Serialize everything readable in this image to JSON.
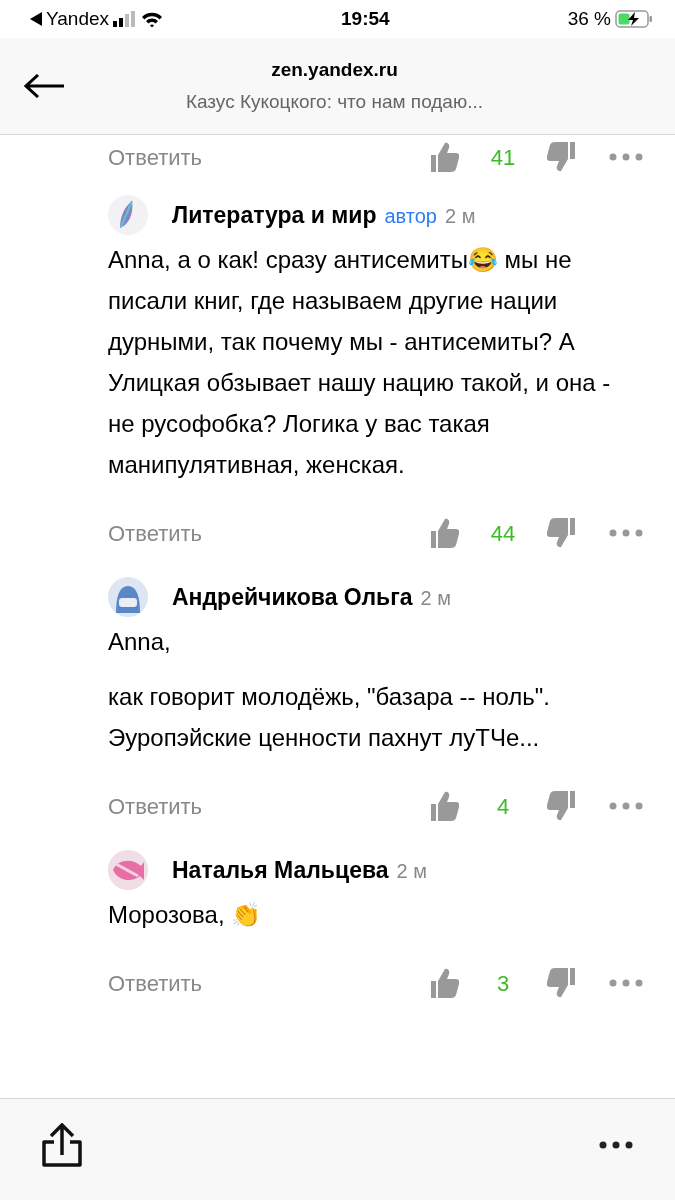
{
  "status_bar": {
    "back_app": "Yandex",
    "time": "19:54",
    "battery": "36 %"
  },
  "header": {
    "site": "zen.yandex.ru",
    "title": "Казус Кукоцкого: что нам подаю..."
  },
  "previous_actions": {
    "reply": "Ответить",
    "likes": "41"
  },
  "comments": [
    {
      "author": "Литература и мир",
      "badge": "автор",
      "time": "2 м",
      "paragraphs": [
        "Anna, а о как! сразу антисемиты😂 мы не писали книг, где называем другие нации дурными, так почему мы - антисемиты? А Улицкая обзывает нашу нацию такой, и она - не русофобка? Логика у вас такая манипулятивная, женская."
      ],
      "reply": "Ответить",
      "likes": "44"
    },
    {
      "author": "Андрейчикова Ольга",
      "time": "2 м",
      "paragraphs": [
        "Anna,",
        "как говорит молодёжь, \"базара -- ноль\". Эуропэйские ценности пахнут луТЧе..."
      ],
      "reply": "Ответить",
      "likes": "4"
    },
    {
      "author": "Наталья Мальцева",
      "time": "2 м",
      "paragraphs": [
        "Морозова, 👏"
      ],
      "reply": "Ответить",
      "likes": "3"
    }
  ]
}
